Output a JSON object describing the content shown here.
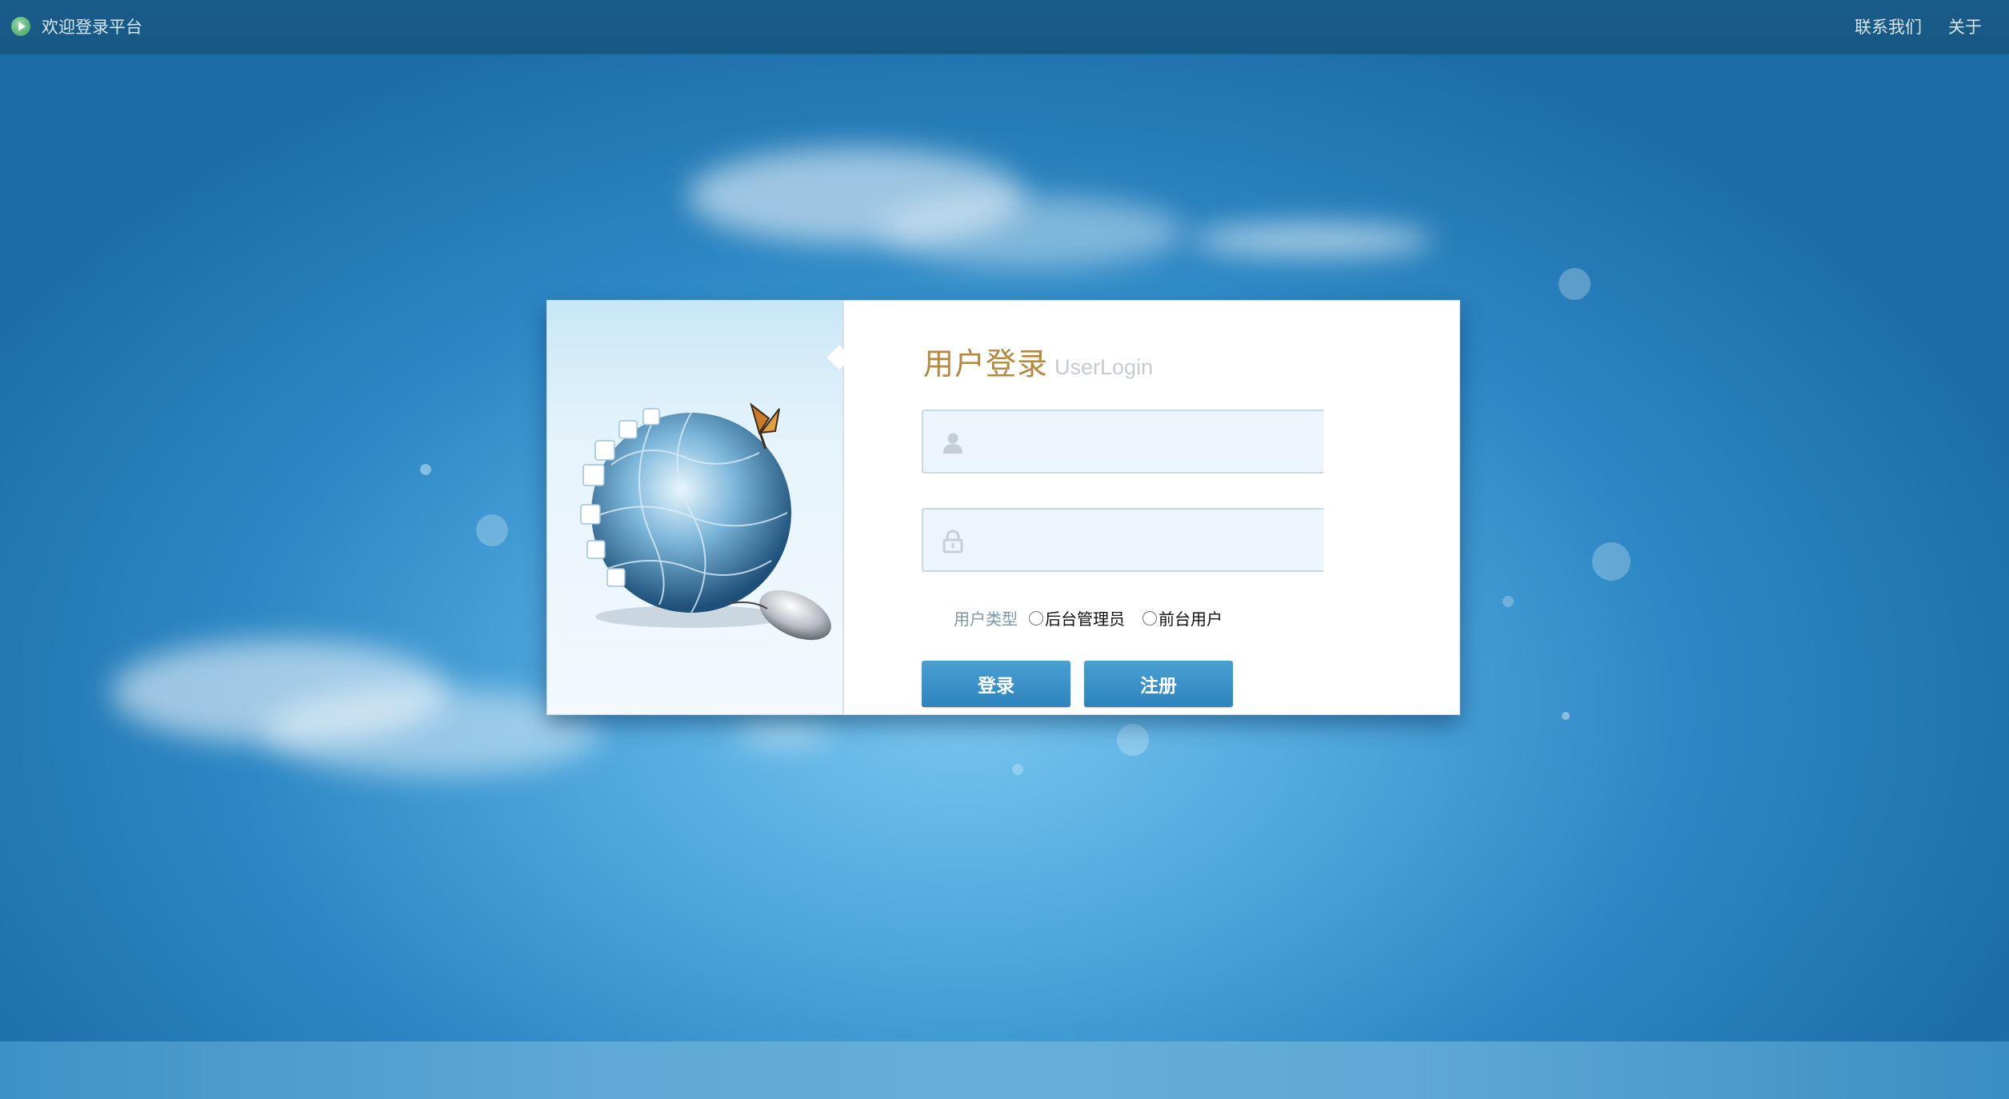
{
  "header": {
    "title": "欢迎登录平台",
    "nav": [
      {
        "label": "联系我们"
      },
      {
        "label": "关于"
      }
    ]
  },
  "login": {
    "title_cn": "用户登录",
    "title_en": "UserLogin",
    "username": {
      "value": "",
      "placeholder": "",
      "icon": "user-icon"
    },
    "password": {
      "value": "",
      "placeholder": "",
      "icon": "lock-icon"
    },
    "user_type": {
      "label": "用户类型",
      "options": [
        {
          "label": "后台管理员",
          "checked": false
        },
        {
          "label": "前台用户",
          "checked": false
        }
      ]
    },
    "login_button": "登录",
    "register_button": "注册"
  },
  "colors": {
    "accent": "#2d84bd",
    "title_gold": "#b4883e",
    "header_bg": "#175784"
  }
}
